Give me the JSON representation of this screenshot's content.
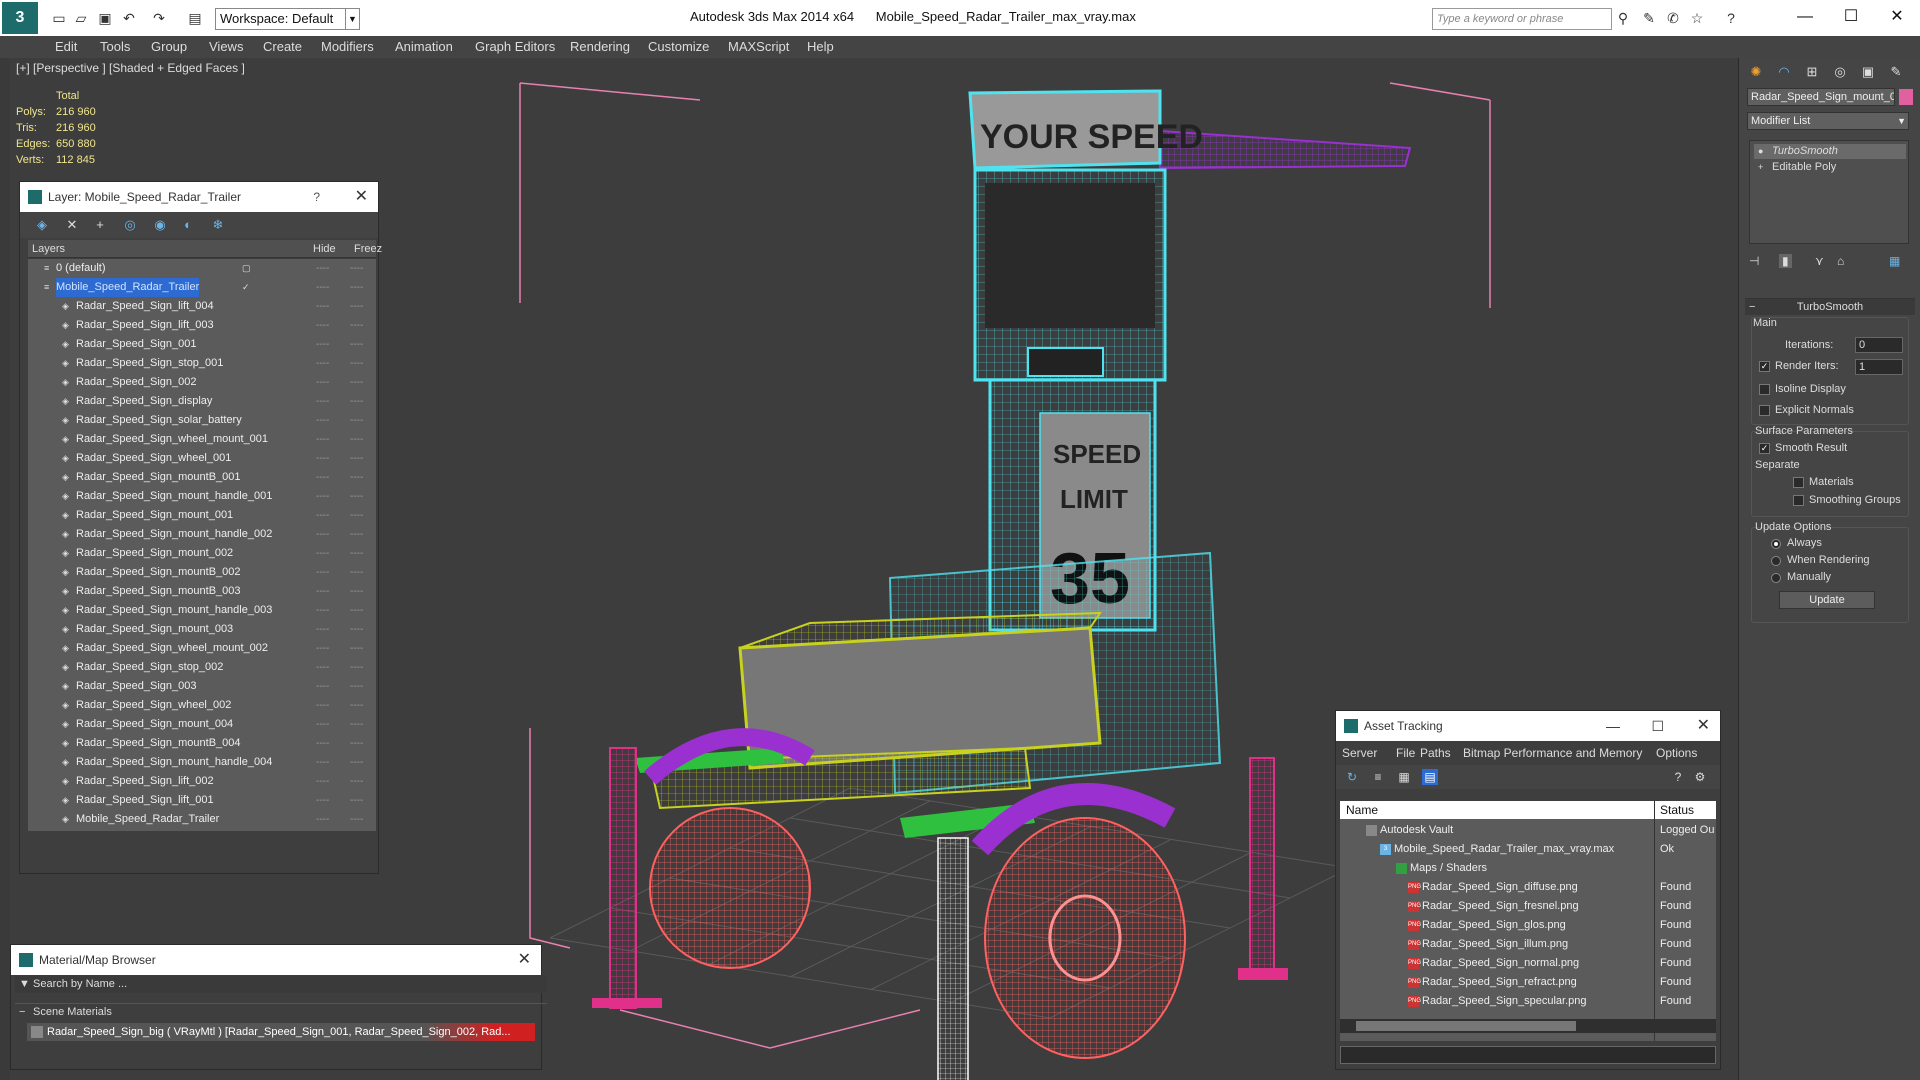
{
  "titlebar": {
    "app_title": "Autodesk 3ds Max  2014 x64",
    "file_title": "Mobile_Speed_Radar_Trailer_max_vray.max",
    "workspace": "Workspace: Default",
    "search_placeholder": "Type a keyword or phrase"
  },
  "menu": [
    "Edit",
    "Tools",
    "Group",
    "Views",
    "Create",
    "Modifiers",
    "Animation",
    "Graph Editors",
    "Rendering",
    "Customize",
    "MAXScript",
    "Help"
  ],
  "viewport": {
    "label": "[+] [Perspective ] [Shaded + Edged Faces ]",
    "stats": {
      "total_label": "Total",
      "polys_label": "Polys:",
      "polys": "216 960",
      "tris_label": "Tris:",
      "tris": "216 960",
      "edges_label": "Edges:",
      "edges": "650 880",
      "verts_label": "Verts:",
      "verts": "112 845"
    },
    "sign_top": "YOUR SPEED",
    "sign_line1": "SPEED",
    "sign_line2": "LIMIT",
    "sign_number": "35"
  },
  "layer_panel": {
    "title": "Layer: Mobile_Speed_Radar_Trailer",
    "help": "?",
    "col_layers": "Layers",
    "col_hide": "Hide",
    "col_freeze": "Freez",
    "rows": [
      {
        "name": "0 (default)",
        "level": 0
      },
      {
        "name": "Mobile_Speed_Radar_Trailer",
        "level": 0
      },
      {
        "name": "Radar_Speed_Sign_lift_004",
        "level": 1
      },
      {
        "name": "Radar_Speed_Sign_lift_003",
        "level": 1
      },
      {
        "name": "Radar_Speed_Sign_001",
        "level": 1
      },
      {
        "name": "Radar_Speed_Sign_stop_001",
        "level": 1
      },
      {
        "name": "Radar_Speed_Sign_002",
        "level": 1
      },
      {
        "name": "Radar_Speed_Sign_display",
        "level": 1
      },
      {
        "name": "Radar_Speed_Sign_solar_battery",
        "level": 1
      },
      {
        "name": "Radar_Speed_Sign_wheel_mount_001",
        "level": 1
      },
      {
        "name": "Radar_Speed_Sign_wheel_001",
        "level": 1
      },
      {
        "name": "Radar_Speed_Sign_mountB_001",
        "level": 1
      },
      {
        "name": "Radar_Speed_Sign_mount_handle_001",
        "level": 1
      },
      {
        "name": "Radar_Speed_Sign_mount_001",
        "level": 1
      },
      {
        "name": "Radar_Speed_Sign_mount_handle_002",
        "level": 1
      },
      {
        "name": "Radar_Speed_Sign_mount_002",
        "level": 1
      },
      {
        "name": "Radar_Speed_Sign_mountB_002",
        "level": 1
      },
      {
        "name": "Radar_Speed_Sign_mountB_003",
        "level": 1
      },
      {
        "name": "Radar_Speed_Sign_mount_handle_003",
        "level": 1
      },
      {
        "name": "Radar_Speed_Sign_mount_003",
        "level": 1
      },
      {
        "name": "Radar_Speed_Sign_wheel_mount_002",
        "level": 1
      },
      {
        "name": "Radar_Speed_Sign_stop_002",
        "level": 1
      },
      {
        "name": "Radar_Speed_Sign_003",
        "level": 1
      },
      {
        "name": "Radar_Speed_Sign_wheel_002",
        "level": 1
      },
      {
        "name": "Radar_Speed_Sign_mount_004",
        "level": 1
      },
      {
        "name": "Radar_Speed_Sign_mountB_004",
        "level": 1
      },
      {
        "name": "Radar_Speed_Sign_mount_handle_004",
        "level": 1
      },
      {
        "name": "Radar_Speed_Sign_lift_002",
        "level": 1
      },
      {
        "name": "Radar_Speed_Sign_lift_001",
        "level": 1
      },
      {
        "name": "Mobile_Speed_Radar_Trailer",
        "level": 1
      }
    ]
  },
  "material_browser": {
    "title": "Material/Map Browser",
    "search": "Search by Name ...",
    "category": "Scene Materials",
    "item": "Radar_Speed_Sign_big  ( VRayMtl ) [Radar_Speed_Sign_001, Radar_Speed_Sign_002, Rad..."
  },
  "asset_tracking": {
    "title": "Asset Tracking",
    "menu": [
      "Server",
      "File",
      "Paths",
      "Bitmap Performance and Memory",
      "Options"
    ],
    "col_name": "Name",
    "col_status": "Status",
    "rows": [
      {
        "name": "Autodesk Vault",
        "status": "Logged Ou",
        "level": 1
      },
      {
        "name": "Mobile_Speed_Radar_Trailer_max_vray.max",
        "status": "Ok",
        "level": 2
      },
      {
        "name": "Maps / Shaders",
        "status": "",
        "level": 3
      },
      {
        "name": "Radar_Speed_Sign_diffuse.png",
        "status": "Found",
        "level": 4
      },
      {
        "name": "Radar_Speed_Sign_fresnel.png",
        "status": "Found",
        "level": 4
      },
      {
        "name": "Radar_Speed_Sign_glos.png",
        "status": "Found",
        "level": 4
      },
      {
        "name": "Radar_Speed_Sign_illum.png",
        "status": "Found",
        "level": 4
      },
      {
        "name": "Radar_Speed_Sign_normal.png",
        "status": "Found",
        "level": 4
      },
      {
        "name": "Radar_Speed_Sign_refract.png",
        "status": "Found",
        "level": 4
      },
      {
        "name": "Radar_Speed_Sign_specular.png",
        "status": "Found",
        "level": 4
      }
    ]
  },
  "command_panel": {
    "object_name": "Radar_Speed_Sign_mount_0",
    "object_color": "#e060a0",
    "modifier_list": "Modifier List",
    "stack": [
      "TurboSmooth",
      "Editable Poly"
    ],
    "rollout_title": "TurboSmooth",
    "main_label": "Main",
    "iterations_label": "Iterations:",
    "iterations": "0",
    "render_iters_label": "Render Iters:",
    "render_iters": "1",
    "isoline_label": "Isoline Display",
    "explicit_normals_label": "Explicit Normals",
    "surface_params_label": "Surface Parameters",
    "smooth_result_label": "Smooth Result",
    "separate_label": "Separate",
    "materials_label": "Materials",
    "smoothing_groups_label": "Smoothing Groups",
    "update_options_label": "Update Options",
    "always_label": "Always",
    "when_rendering_label": "When Rendering",
    "manually_label": "Manually",
    "update_button": "Update"
  },
  "colors": {
    "cyan_wire": "#4fe3f0",
    "yellow_wire": "#c8d21e",
    "magenta_wire": "#e0308a",
    "red_wire": "#ff6060",
    "purple_wire": "#9a30d0",
    "green_wire": "#30c040",
    "selection_blue": "#2d6bd2"
  }
}
